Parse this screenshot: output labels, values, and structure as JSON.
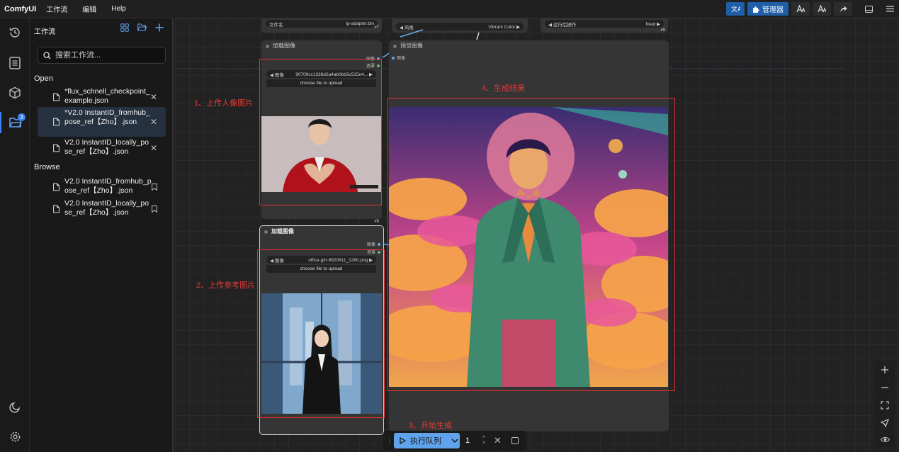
{
  "menubar": {
    "brand": "ComfyUI",
    "items": [
      "工作流",
      "编辑",
      "Help"
    ],
    "manager_label": "管理器"
  },
  "rail": {
    "badge_count": "3"
  },
  "sidebar": {
    "title": "工作流",
    "search_placeholder": "搜索工作流...",
    "open_label": "Open",
    "open_items": [
      "*flux_schnell_checkpoint_example.json",
      "*V2.0 InstantID_fromhub_pose_ref【Zho】.json",
      "V2.0 InstantID_locally_pose_ref【Zho】.json"
    ],
    "browse_label": "Browse",
    "browse_items": [
      "V2.0 InstantID_fromhub_pose_ref【Zho】.json",
      "V2.0 InstantID_locally_pose_ref【Zho】.json"
    ]
  },
  "canvas": {
    "top_nodes": {
      "left_widget_label": "文件名",
      "left_widget_value": "ip-adapter.bin",
      "left_id": "#7",
      "mid_widget_label": "风格",
      "mid_widget_value": "Vibrant Color",
      "right_widget_label": "运行后操作",
      "right_widget_value": "fixed",
      "right_id": "#9"
    },
    "load_image_1": {
      "title": "加载图像",
      "out_image": "图像",
      "out_mask": "遮罩",
      "image_label": "图像",
      "image_value": "90709cc1338d2a4ab0bb5c515e4...",
      "upload_label": "choose file to upload",
      "id": "#8"
    },
    "load_image_2": {
      "title": "加载图像",
      "out_image": "图像",
      "out_mask": "遮罩",
      "image_label": "图像",
      "image_value": "office-girl-8920611_1280.png",
      "upload_label": "choose file to upload"
    },
    "preview": {
      "title": "预览图像",
      "in_image": "图像"
    },
    "annotations": {
      "step1": "1、上传人像图片",
      "step2": "2、上传参考图片",
      "step3": "3、开始生成",
      "step4": "4、生成结果"
    }
  },
  "queue": {
    "run_label": "执行队列",
    "count": "1"
  }
}
